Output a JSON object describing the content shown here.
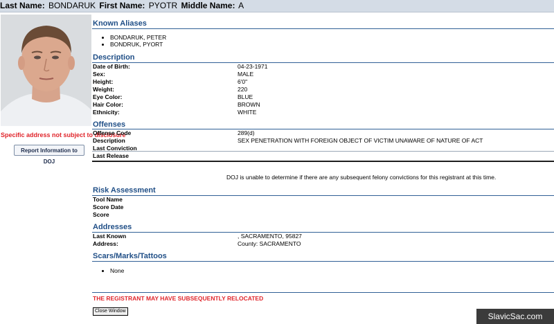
{
  "header": {
    "last_name_label": "Last Name:",
    "last_name": "BONDARUK",
    "first_name_label": "First Name:",
    "first_name": "PYOTR",
    "middle_name_label": "Middle Name:",
    "middle_name": "A"
  },
  "sidebar": {
    "disclosure_note": "Specific address not subject to disclosure",
    "report_button": "Report Information to DOJ"
  },
  "aliases": {
    "title": "Known Aliases",
    "items": [
      "BONDARUK, PETER",
      "BONDRUK, PYORT"
    ]
  },
  "description": {
    "title": "Description",
    "rows": [
      {
        "label": "Date of Birth:",
        "value": "04-23-1971"
      },
      {
        "label": "Sex:",
        "value": "MALE"
      },
      {
        "label": "Height:",
        "value": "6'0\""
      },
      {
        "label": "Weight:",
        "value": "220"
      },
      {
        "label": "Eye Color:",
        "value": "BLUE"
      },
      {
        "label": "Hair Color:",
        "value": "BROWN"
      },
      {
        "label": "Ethnicity:",
        "value": "WHITE"
      }
    ]
  },
  "offenses": {
    "title": "Offenses",
    "rows": [
      {
        "label": "Offense Code",
        "value": "289(d)"
      },
      {
        "label": "Description",
        "value": "SEX PENETRATION WITH FOREIGN OBJECT OF VICTIM UNAWARE OF NATURE OF ACT"
      },
      {
        "label": "Last Conviction",
        "value": ""
      },
      {
        "label": "Last Release",
        "value": ""
      }
    ],
    "doj_note": "DOJ is unable to determine if there are any subsequent felony convictions for this registrant at this time."
  },
  "risk": {
    "title": "Risk Assessment",
    "rows": [
      {
        "label": "Tool Name",
        "value": ""
      },
      {
        "label": "Score Date",
        "value": ""
      },
      {
        "label": "Score",
        "value": ""
      }
    ]
  },
  "addresses": {
    "title": "Addresses",
    "rows": [
      {
        "label": "Last Known",
        "value": ", SACRAMENTO, 95827"
      },
      {
        "label": "Address:",
        "value": "County: SACRAMENTO"
      }
    ]
  },
  "scars": {
    "title": "Scars/Marks/Tattoos",
    "items": [
      "None"
    ]
  },
  "footer": {
    "relocated_note": "THE REGISTRANT MAY HAVE SUBSEQUENTLY RELOCATED",
    "close_button": "Close Window",
    "watermark": "SlavicSac.com"
  }
}
